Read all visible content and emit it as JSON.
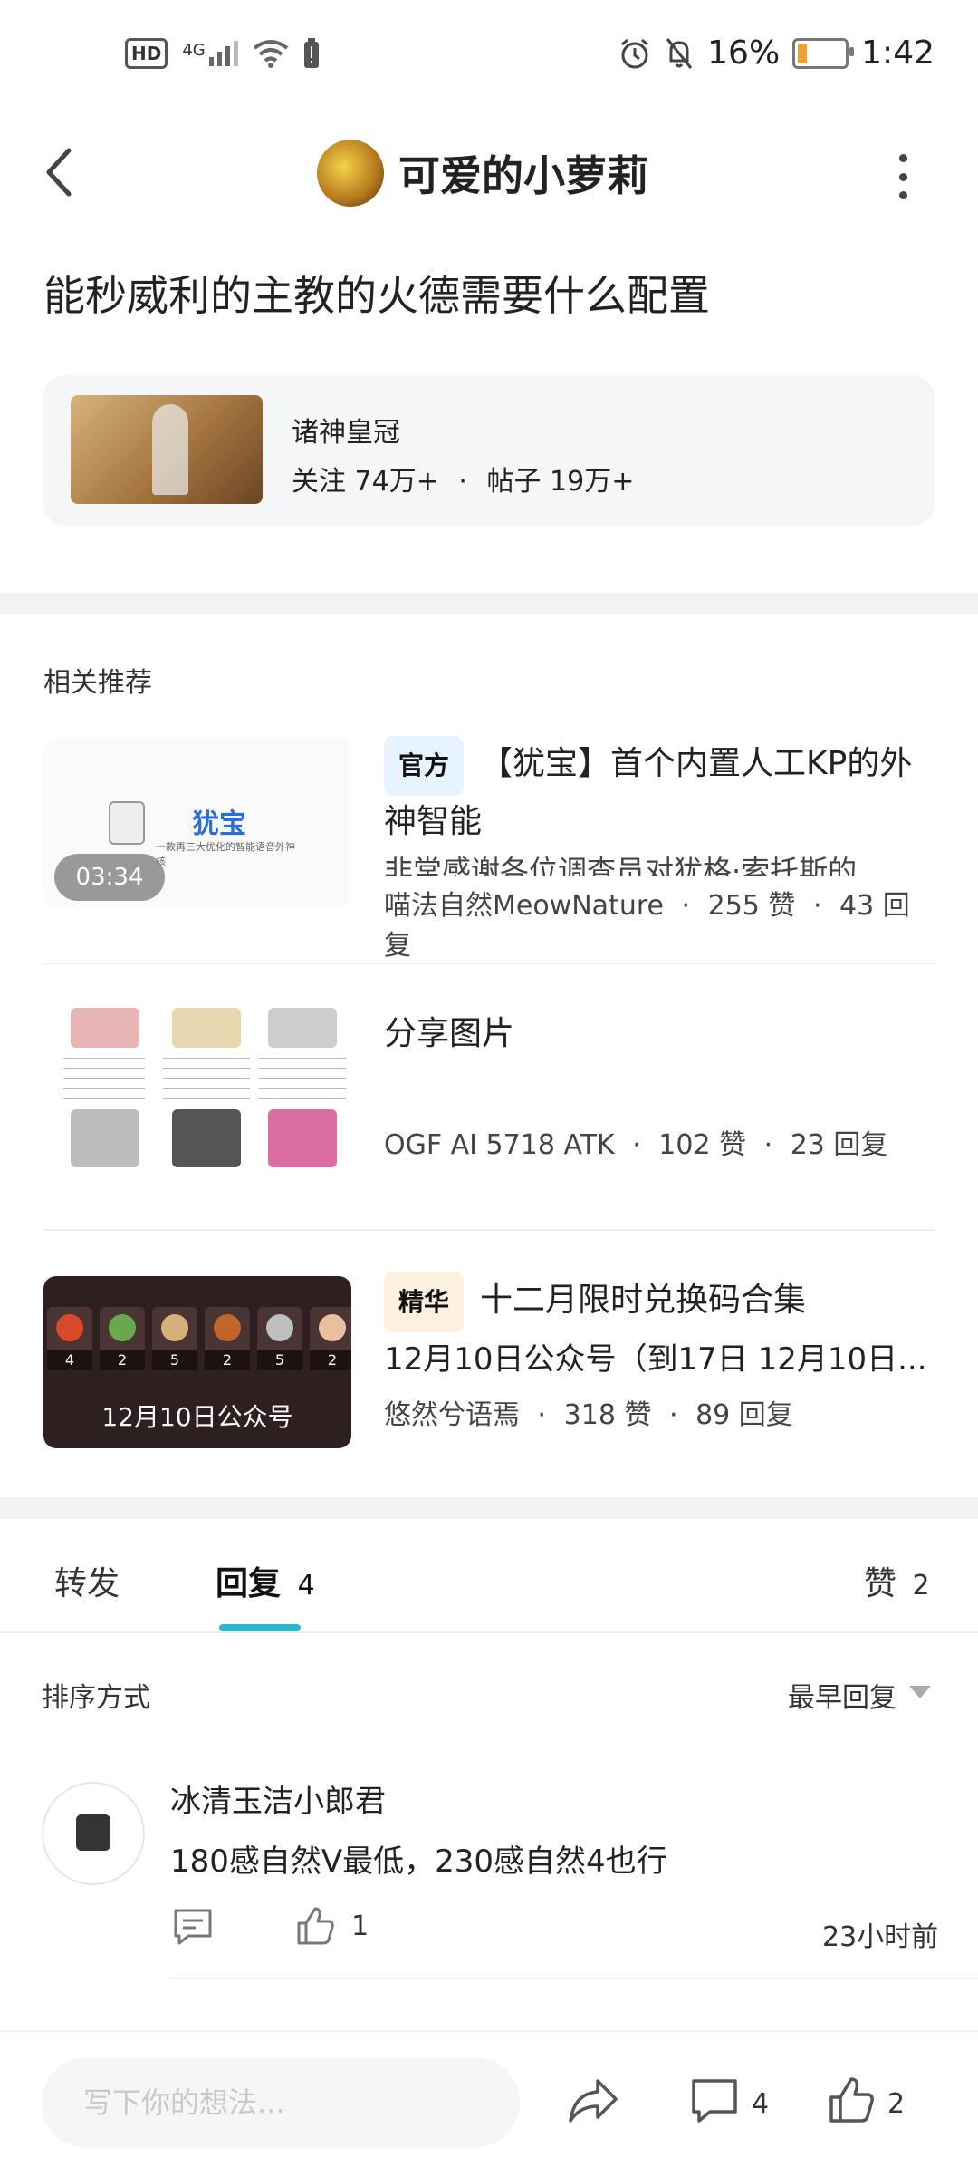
{
  "status_bar": {
    "left_icons": [
      "hd-icon",
      "signal-4g-icon",
      "wifi-icon",
      "battery-alert-icon"
    ],
    "hd": "HD",
    "network": "4G",
    "battery_percent": "16%",
    "time": "1:42"
  },
  "header": {
    "title": "可爱的小萝莉"
  },
  "post": {
    "title": "能秒威利的主教的火德需要什么配置"
  },
  "forum": {
    "name": "诸神皇冠",
    "follows": "关注 74万+",
    "posts": "帖子 19万+",
    "dot": "·"
  },
  "recommend": {
    "label": "相关推荐",
    "items": [
      {
        "tag": "官方",
        "title": "【犹宝】首个内置人工KP的外神智能",
        "excerpt": "非常感谢各位调查员对犹格·索托斯的",
        "author": "喵法自然MeowNature",
        "likes": "255 赞",
        "replies": "43 回复",
        "duration": "03:34",
        "thumb_title": "犹宝",
        "thumb_sub": "一款再三大优化的智能语音外神核"
      },
      {
        "tag": "",
        "title": "分享图片",
        "author": "OGF AI 5718 ATK",
        "likes": "102 赞",
        "replies": "23 回复"
      },
      {
        "tag": "精华",
        "title": "十二月限时兑换码合集",
        "excerpt": "12月10日公众号（到17日  12月10日...",
        "author": "悠然兮语焉",
        "likes": "318 赞",
        "replies": "89 回复",
        "thumb_caption": "12月10日公众号",
        "thumb_counts": [
          "4",
          "2",
          "5",
          "2",
          "5",
          "2"
        ]
      }
    ]
  },
  "tabs": {
    "forward": "转发",
    "reply": "回复",
    "reply_count": "4",
    "like": "赞",
    "like_count": "2"
  },
  "sort": {
    "label": "排序方式",
    "value": "最早回复"
  },
  "comment": {
    "name": "冰清玉洁小郎君",
    "body": "180感自然V最低，230感自然4也行",
    "like_count": "1",
    "time": "23小时前"
  },
  "bottom": {
    "placeholder": "写下你的想法...",
    "comment_count": "4",
    "like_count": "2"
  }
}
